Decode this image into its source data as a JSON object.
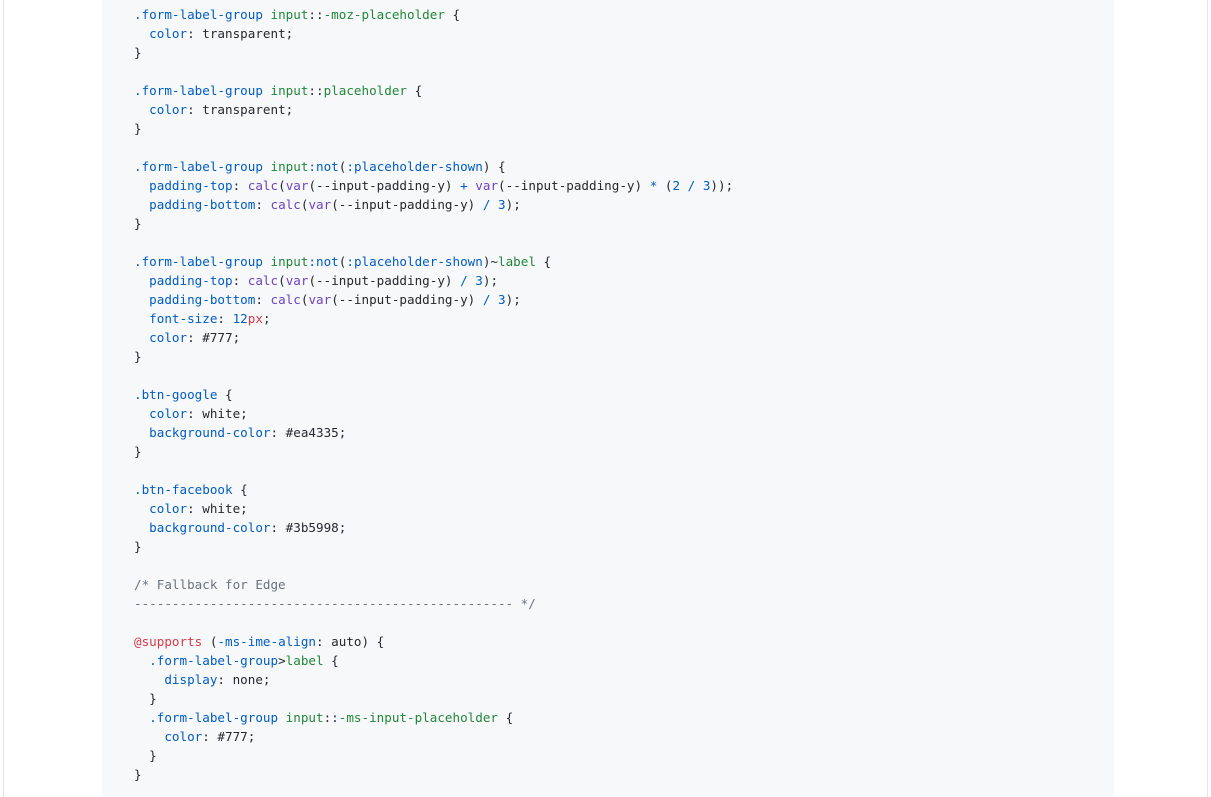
{
  "code": {
    "language": "css",
    "lines": [
      [
        {
          "t": ".form-label-group",
          "c": "css-class"
        },
        {
          "t": " ",
          "c": "plain"
        },
        {
          "t": "input",
          "c": "sel"
        },
        {
          "t": "::",
          "c": "plain"
        },
        {
          "t": "-moz-placeholder",
          "c": "sel"
        },
        {
          "t": " {",
          "c": "plain"
        }
      ],
      [
        {
          "t": "  ",
          "c": "plain"
        },
        {
          "t": "color",
          "c": "prop"
        },
        {
          "t": ": transparent;",
          "c": "plain"
        }
      ],
      [
        {
          "t": "}",
          "c": "plain"
        }
      ],
      [],
      [
        {
          "t": ".form-label-group",
          "c": "css-class"
        },
        {
          "t": " ",
          "c": "plain"
        },
        {
          "t": "input",
          "c": "sel"
        },
        {
          "t": "::",
          "c": "plain"
        },
        {
          "t": "placeholder",
          "c": "sel"
        },
        {
          "t": " {",
          "c": "plain"
        }
      ],
      [
        {
          "t": "  ",
          "c": "plain"
        },
        {
          "t": "color",
          "c": "prop"
        },
        {
          "t": ": transparent;",
          "c": "plain"
        }
      ],
      [
        {
          "t": "}",
          "c": "plain"
        }
      ],
      [],
      [
        {
          "t": ".form-label-group",
          "c": "css-class"
        },
        {
          "t": " ",
          "c": "plain"
        },
        {
          "t": "input",
          "c": "sel"
        },
        {
          "t": ":not",
          "c": "css-class"
        },
        {
          "t": "(",
          "c": "plain"
        },
        {
          "t": ":placeholder-shown",
          "c": "css-class"
        },
        {
          "t": ") {",
          "c": "plain"
        }
      ],
      [
        {
          "t": "  ",
          "c": "plain"
        },
        {
          "t": "padding-top",
          "c": "prop"
        },
        {
          "t": ": ",
          "c": "plain"
        },
        {
          "t": "calc",
          "c": "fn"
        },
        {
          "t": "(",
          "c": "plain"
        },
        {
          "t": "var",
          "c": "fn"
        },
        {
          "t": "(--input-padding-y) ",
          "c": "plain"
        },
        {
          "t": "+",
          "c": "op"
        },
        {
          "t": " ",
          "c": "plain"
        },
        {
          "t": "var",
          "c": "fn"
        },
        {
          "t": "(--input-padding-y) ",
          "c": "plain"
        },
        {
          "t": "*",
          "c": "op"
        },
        {
          "t": " (",
          "c": "plain"
        },
        {
          "t": "2",
          "c": "num"
        },
        {
          "t": " ",
          "c": "plain"
        },
        {
          "t": "/",
          "c": "op"
        },
        {
          "t": " ",
          "c": "plain"
        },
        {
          "t": "3",
          "c": "num"
        },
        {
          "t": "));",
          "c": "plain"
        }
      ],
      [
        {
          "t": "  ",
          "c": "plain"
        },
        {
          "t": "padding-bottom",
          "c": "prop"
        },
        {
          "t": ": ",
          "c": "plain"
        },
        {
          "t": "calc",
          "c": "fn"
        },
        {
          "t": "(",
          "c": "plain"
        },
        {
          "t": "var",
          "c": "fn"
        },
        {
          "t": "(--input-padding-y) ",
          "c": "plain"
        },
        {
          "t": "/",
          "c": "op"
        },
        {
          "t": " ",
          "c": "plain"
        },
        {
          "t": "3",
          "c": "num"
        },
        {
          "t": ");",
          "c": "plain"
        }
      ],
      [
        {
          "t": "}",
          "c": "plain"
        }
      ],
      [],
      [
        {
          "t": ".form-label-group",
          "c": "css-class"
        },
        {
          "t": " ",
          "c": "plain"
        },
        {
          "t": "input",
          "c": "sel"
        },
        {
          "t": ":not",
          "c": "css-class"
        },
        {
          "t": "(",
          "c": "plain"
        },
        {
          "t": ":placeholder-shown",
          "c": "css-class"
        },
        {
          "t": ")~",
          "c": "plain"
        },
        {
          "t": "label",
          "c": "sel"
        },
        {
          "t": " {",
          "c": "plain"
        }
      ],
      [
        {
          "t": "  ",
          "c": "plain"
        },
        {
          "t": "padding-top",
          "c": "prop"
        },
        {
          "t": ": ",
          "c": "plain"
        },
        {
          "t": "calc",
          "c": "fn"
        },
        {
          "t": "(",
          "c": "plain"
        },
        {
          "t": "var",
          "c": "fn"
        },
        {
          "t": "(--input-padding-y) ",
          "c": "plain"
        },
        {
          "t": "/",
          "c": "op"
        },
        {
          "t": " ",
          "c": "plain"
        },
        {
          "t": "3",
          "c": "num"
        },
        {
          "t": ");",
          "c": "plain"
        }
      ],
      [
        {
          "t": "  ",
          "c": "plain"
        },
        {
          "t": "padding-bottom",
          "c": "prop"
        },
        {
          "t": ": ",
          "c": "plain"
        },
        {
          "t": "calc",
          "c": "fn"
        },
        {
          "t": "(",
          "c": "plain"
        },
        {
          "t": "var",
          "c": "fn"
        },
        {
          "t": "(--input-padding-y) ",
          "c": "plain"
        },
        {
          "t": "/",
          "c": "op"
        },
        {
          "t": " ",
          "c": "plain"
        },
        {
          "t": "3",
          "c": "num"
        },
        {
          "t": ");",
          "c": "plain"
        }
      ],
      [
        {
          "t": "  ",
          "c": "plain"
        },
        {
          "t": "font-size",
          "c": "prop"
        },
        {
          "t": ": ",
          "c": "plain"
        },
        {
          "t": "12",
          "c": "num"
        },
        {
          "t": "px",
          "c": "at"
        },
        {
          "t": ";",
          "c": "plain"
        }
      ],
      [
        {
          "t": "  ",
          "c": "plain"
        },
        {
          "t": "color",
          "c": "prop"
        },
        {
          "t": ": ",
          "c": "plain"
        },
        {
          "t": "#777",
          "c": "plain"
        },
        {
          "t": ";",
          "c": "plain"
        }
      ],
      [
        {
          "t": "}",
          "c": "plain"
        }
      ],
      [],
      [
        {
          "t": ".btn-google",
          "c": "css-class"
        },
        {
          "t": " {",
          "c": "plain"
        }
      ],
      [
        {
          "t": "  ",
          "c": "plain"
        },
        {
          "t": "color",
          "c": "prop"
        },
        {
          "t": ": white;",
          "c": "plain"
        }
      ],
      [
        {
          "t": "  ",
          "c": "plain"
        },
        {
          "t": "background-color",
          "c": "prop"
        },
        {
          "t": ": #ea4335;",
          "c": "plain"
        }
      ],
      [
        {
          "t": "}",
          "c": "plain"
        }
      ],
      [],
      [
        {
          "t": ".btn-facebook",
          "c": "css-class"
        },
        {
          "t": " {",
          "c": "plain"
        }
      ],
      [
        {
          "t": "  ",
          "c": "plain"
        },
        {
          "t": "color",
          "c": "prop"
        },
        {
          "t": ": white;",
          "c": "plain"
        }
      ],
      [
        {
          "t": "  ",
          "c": "plain"
        },
        {
          "t": "background-color",
          "c": "prop"
        },
        {
          "t": ": #3b5998;",
          "c": "plain"
        }
      ],
      [
        {
          "t": "}",
          "c": "plain"
        }
      ],
      [],
      [
        {
          "t": "/* Fallback for Edge",
          "c": "cm"
        }
      ],
      [
        {
          "t": "-------------------------------------------------- */",
          "c": "cm"
        }
      ],
      [],
      [
        {
          "t": "@supports",
          "c": "at"
        },
        {
          "t": " (",
          "c": "plain"
        },
        {
          "t": "-ms-ime-align",
          "c": "prop"
        },
        {
          "t": ": auto) {",
          "c": "plain"
        }
      ],
      [
        {
          "t": "  ",
          "c": "plain"
        },
        {
          "t": ".form-label-group",
          "c": "css-class"
        },
        {
          "t": ">",
          "c": "plain"
        },
        {
          "t": "label",
          "c": "sel"
        },
        {
          "t": " {",
          "c": "plain"
        }
      ],
      [
        {
          "t": "    ",
          "c": "plain"
        },
        {
          "t": "display",
          "c": "prop"
        },
        {
          "t": ": none;",
          "c": "plain"
        }
      ],
      [
        {
          "t": "  }",
          "c": "plain"
        }
      ],
      [
        {
          "t": "  ",
          "c": "plain"
        },
        {
          "t": ".form-label-group",
          "c": "css-class"
        },
        {
          "t": " ",
          "c": "plain"
        },
        {
          "t": "input",
          "c": "sel"
        },
        {
          "t": "::",
          "c": "plain"
        },
        {
          "t": "-ms-input-placeholder",
          "c": "sel"
        },
        {
          "t": " {",
          "c": "plain"
        }
      ],
      [
        {
          "t": "    ",
          "c": "plain"
        },
        {
          "t": "color",
          "c": "prop"
        },
        {
          "t": ": #777;",
          "c": "plain"
        }
      ],
      [
        {
          "t": "  }",
          "c": "plain"
        }
      ],
      [
        {
          "t": "}",
          "c": "plain"
        }
      ]
    ]
  }
}
